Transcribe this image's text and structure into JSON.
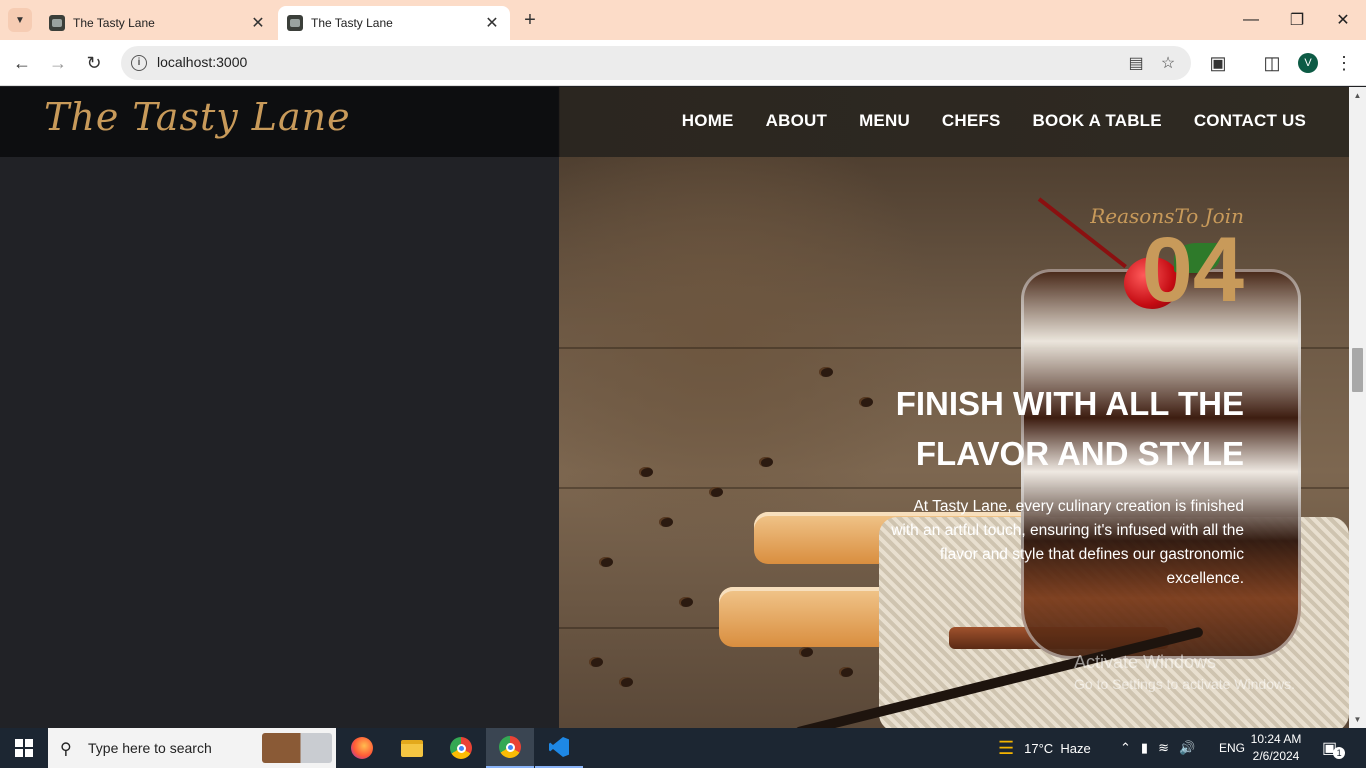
{
  "browser": {
    "tabs": [
      {
        "title": "The Tasty Lane",
        "active": false
      },
      {
        "title": "The Tasty Lane",
        "active": true
      }
    ],
    "url": "localhost:3000",
    "profile_initial": "V"
  },
  "site": {
    "brand": "The Tasty Lane",
    "nav": [
      "HOME",
      "ABOUT",
      "MENU",
      "CHEFS",
      "BOOK A TABLE",
      "CONTACT US"
    ],
    "section": {
      "kicker": "ReasonsTo Join",
      "number": "04",
      "heading_line1": "FINISH WITH ALL THE",
      "heading_line2": "FLAVOR AND STYLE",
      "description": "At Tasty Lane, every culinary creation is finished with an artful touch, ensuring it's infused with all the flavor and style that defines our gastronomic excellence."
    },
    "watermark": {
      "line1": "Activate Windows",
      "line2": "Go to Settings to activate Windows."
    }
  },
  "taskbar": {
    "search_placeholder": "Type here to search",
    "weather": "17°C  Haze",
    "language": "ENG",
    "time": "10:24 AM",
    "date": "2/6/2024",
    "notifications": "1"
  },
  "colors": {
    "accent_gold": "#c89a5a",
    "panel_dark": "#212226",
    "tabstrip": "#fcdcc8"
  }
}
